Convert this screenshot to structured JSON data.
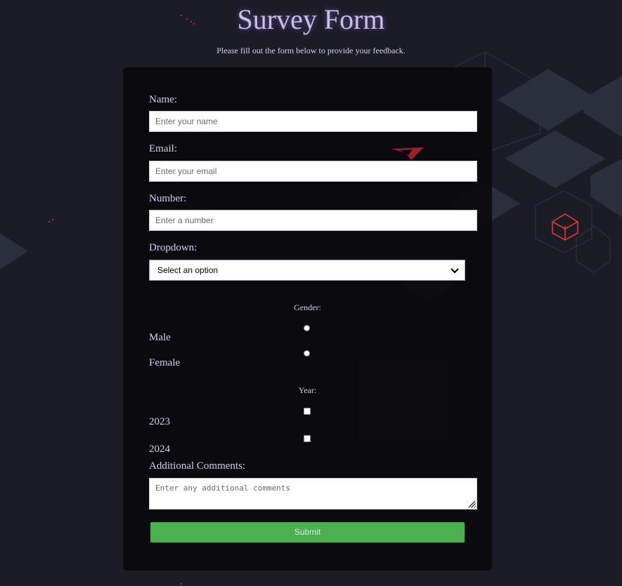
{
  "page": {
    "title": "Survey Form",
    "description": "Please fill out the form below to provide your feedback."
  },
  "form": {
    "name": {
      "label": "Name:",
      "placeholder": "Enter your name",
      "value": ""
    },
    "email": {
      "label": "Email:",
      "placeholder": "Enter your email",
      "value": ""
    },
    "number": {
      "label": "Number:",
      "placeholder": "Enter a number",
      "value": ""
    },
    "dropdown": {
      "label": "Dropdown:",
      "selected": "Select an option"
    },
    "gender": {
      "label": "Gender:",
      "options": [
        "Male",
        "Female"
      ]
    },
    "year": {
      "label": "Year:",
      "options": [
        "2023",
        "2024"
      ]
    },
    "comments": {
      "label": "Additional Comments:",
      "placeholder": "Enter any additional comments",
      "value": ""
    },
    "submit_label": "Submit"
  },
  "colors": {
    "background": "#1c1c26",
    "card": "#0b0b0f",
    "label_text": "#d7ccf0",
    "title_text": "#c9bfe8",
    "submit_button": "#4caf50",
    "accent_red": "#d83a3a"
  },
  "icons": {
    "dropdown_arrow": "chevron-down-icon",
    "resize": "resize-grip-icon"
  }
}
